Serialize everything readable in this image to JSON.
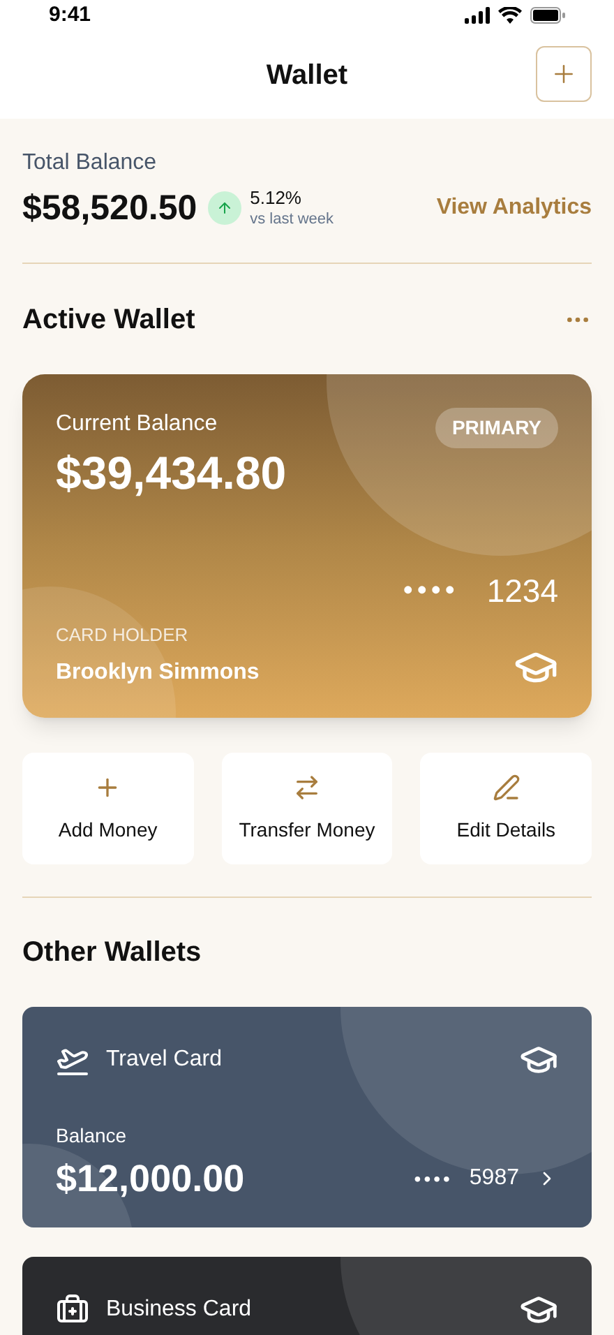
{
  "status_bar": {
    "time": "9:41"
  },
  "header": {
    "title": "Wallet"
  },
  "total": {
    "label": "Total Balance",
    "amount": "$58,520.50",
    "rising": true,
    "change": "5.12%",
    "period": "vs last week",
    "link": "View Analytics"
  },
  "active_wallet": {
    "heading": "Active Wallet",
    "card": {
      "label": "Current Balance",
      "amount": "$39,434.80",
      "badge": "PRIMARY",
      "dots": "••••",
      "last4": "1234",
      "holder_label": "CARD HOLDER",
      "holder": "Brooklyn Simmons"
    }
  },
  "actions": [
    {
      "kind": "add",
      "label": "Add Money"
    },
    {
      "kind": "transfer",
      "label": "Transfer Money"
    },
    {
      "kind": "edit",
      "label": "Edit Details"
    }
  ],
  "other_wallets": {
    "heading": "Other Wallets",
    "wallets": [
      {
        "kind": "travel",
        "name": "Travel Card",
        "balance_label": "Balance",
        "amount": "$12,000.00",
        "dots": "••••",
        "last4": "5987"
      },
      {
        "kind": "business",
        "name": "Business Card"
      }
    ]
  }
}
